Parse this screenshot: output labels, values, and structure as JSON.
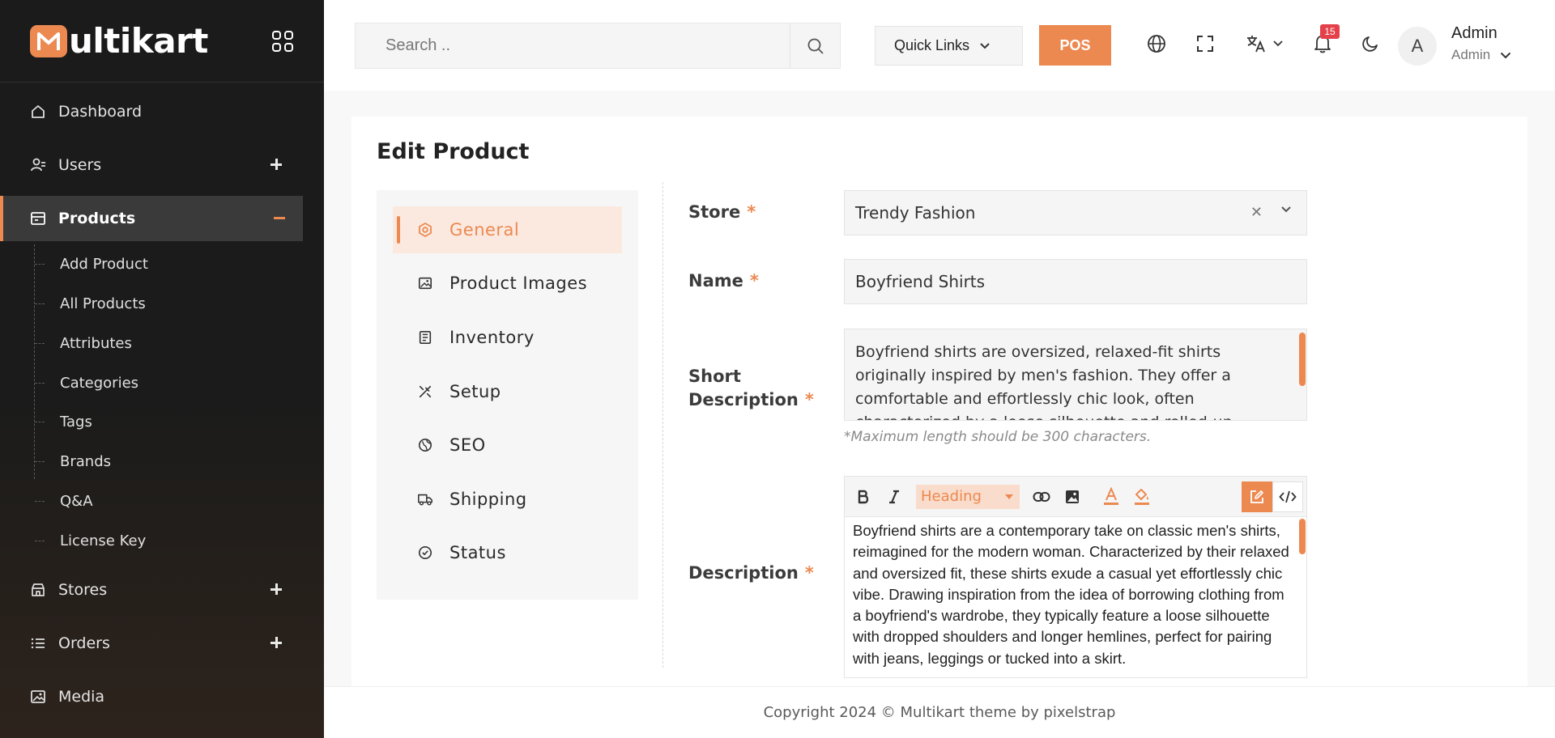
{
  "brand": {
    "logo_text": "ultikart",
    "logo_letter": "M"
  },
  "sidebar": {
    "items": [
      {
        "label": "Dashboard",
        "icon": "home-icon"
      },
      {
        "label": "Users",
        "icon": "users-icon"
      },
      {
        "label": "Products",
        "icon": "products-icon"
      },
      {
        "label": "Stores",
        "icon": "store-icon"
      },
      {
        "label": "Orders",
        "icon": "orders-icon"
      },
      {
        "label": "Media",
        "icon": "image-icon"
      }
    ],
    "products_submenu": [
      "Add Product",
      "All Products",
      "Attributes",
      "Categories",
      "Tags",
      "Brands",
      "Q&A",
      "License Key"
    ]
  },
  "header": {
    "search_placeholder": "Search ..",
    "quick_links": "Quick Links",
    "pos": "POS",
    "notification_count": "15",
    "avatar_letter": "A",
    "user_name": "Admin",
    "user_role": "Admin"
  },
  "page": {
    "title": "Edit Product",
    "tabs": [
      "General",
      "Product Images",
      "Inventory",
      "Setup",
      "SEO",
      "Shipping",
      "Status"
    ],
    "active_tab": "General",
    "form": {
      "store_label": "Store",
      "store_value": "Trendy Fashion",
      "name_label": "Name",
      "name_value": "Boyfriend Shirts",
      "short_desc_label_1": "Short",
      "short_desc_label_2": "Description",
      "short_desc_value": "Boyfriend shirts are oversized, relaxed-fit shirts originally inspired by men's fashion. They offer a comfortable and effortlessly chic look, often characterized by a loose silhouette and rolled-up sleeves.",
      "short_desc_hint": "*Maximum length should be 300 characters.",
      "description_label": "Description",
      "editor_heading": "Heading",
      "description_value": "Boyfriend shirts are a contemporary take on classic men's shirts, reimagined for the modern woman. Characterized by their relaxed and oversized fit, these shirts exude a casual yet effortlessly chic vibe. Drawing inspiration from the idea of borrowing clothing from a boyfriend's wardrobe, they typically feature a loose silhouette with dropped shoulders and longer hemlines, perfect for pairing with jeans, leggings or tucked into a skirt.",
      "required_mark": "*"
    }
  },
  "footer": {
    "text": "Copyright 2024 © Multikart theme by pixelstrap"
  },
  "colors": {
    "accent": "#ec8951",
    "sidebar_bg": "#1b1b1b",
    "badge": "#e4414a"
  }
}
